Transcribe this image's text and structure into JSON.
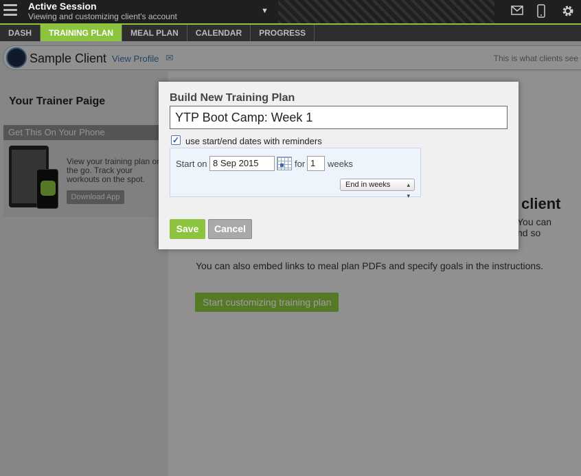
{
  "header": {
    "title": "Active Session",
    "subtitle": "Viewing and customizing client's account",
    "icons": [
      "menu-icon",
      "chevron-down-icon",
      "mail-icon",
      "phone-icon",
      "gear-icon"
    ]
  },
  "nav": {
    "tabs": [
      {
        "label": "DASH",
        "active": false
      },
      {
        "label": "TRAINING PLAN",
        "active": true
      },
      {
        "label": "MEAL PLAN",
        "active": false
      },
      {
        "label": "CALENDAR",
        "active": false
      },
      {
        "label": "PROGRESS",
        "active": false
      }
    ]
  },
  "client": {
    "name": "Sample Client",
    "view_profile": "View Profile",
    "note": "This is what clients see"
  },
  "sidebar": {
    "trainer": "Your Trainer Paige",
    "phone_box": {
      "title": "Get This On Your Phone",
      "description": "View your training plan on the go. Track your workouts on the spot.",
      "button": "Download App"
    }
  },
  "main": {
    "heading": "client",
    "text1": "You can",
    "text2": "nd so",
    "embed": "You can also embed links to meal plan PDFs and specify goals in the instructions.",
    "start_button": "Start customizing training plan"
  },
  "modal": {
    "title": "Build New Training Plan",
    "plan_name": "YTP Boot Camp: Week 1",
    "checkbox_label": "use start/end dates with reminders",
    "checkbox_checked": true,
    "start_label": "Start on",
    "start_date": "8 Sep 2015",
    "for_label": "for",
    "weeks_value": "1",
    "weeks_label": "weeks",
    "end_mode": "End in weeks",
    "save": "Save",
    "cancel": "Cancel"
  },
  "colors": {
    "accent": "#8cc43f",
    "topbar": "#1f1f1f",
    "link": "#3a6ea5"
  }
}
